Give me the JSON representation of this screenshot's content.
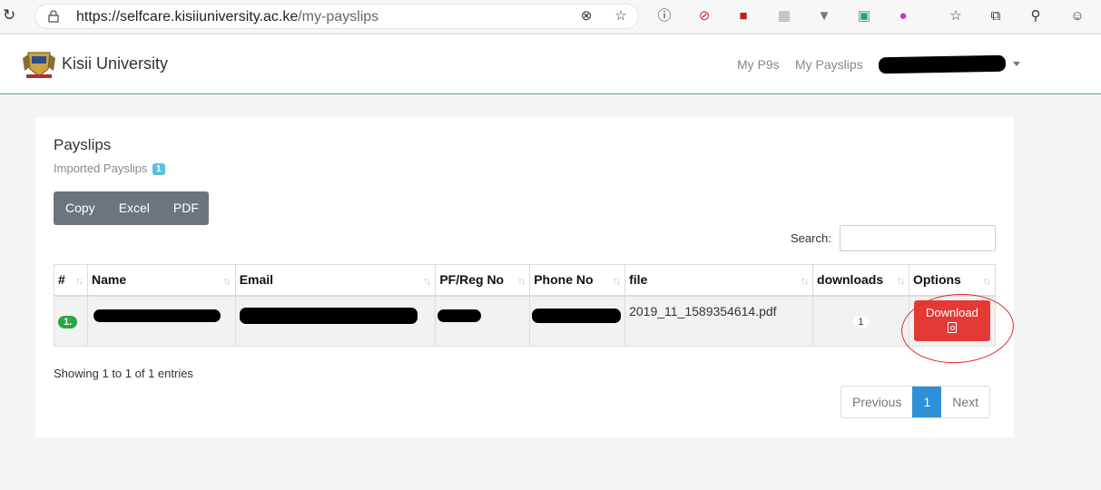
{
  "browser": {
    "url_domain": "https://selfcare.kisiiuniversity.ac.ke",
    "url_path": "/my-payslips"
  },
  "navbar": {
    "brand": "Kisii University",
    "links": [
      "My P9s",
      "My Payslips"
    ]
  },
  "card": {
    "title": "Payslips",
    "subtitle": "Imported Payslips",
    "subtitle_badge": "1",
    "export_buttons": [
      "Copy",
      "Excel",
      "PDF"
    ],
    "search_label": "Search:",
    "table": {
      "headers": [
        "#",
        "Name",
        "Email",
        "PF/Reg No",
        "Phone No",
        "file",
        "downloads",
        "Options"
      ],
      "rows": [
        {
          "index": "1.",
          "file": "2019_11_1589354614.pdf",
          "downloads": "1",
          "action": "Download"
        }
      ]
    },
    "info": "Showing 1 to 1 of 1 entries",
    "pagination": {
      "previous": "Previous",
      "current": "1",
      "next": "Next"
    }
  },
  "colors": {
    "accent_green": "#3cb371",
    "download_red": "#e53935",
    "page_active": "#2f8fd8"
  }
}
